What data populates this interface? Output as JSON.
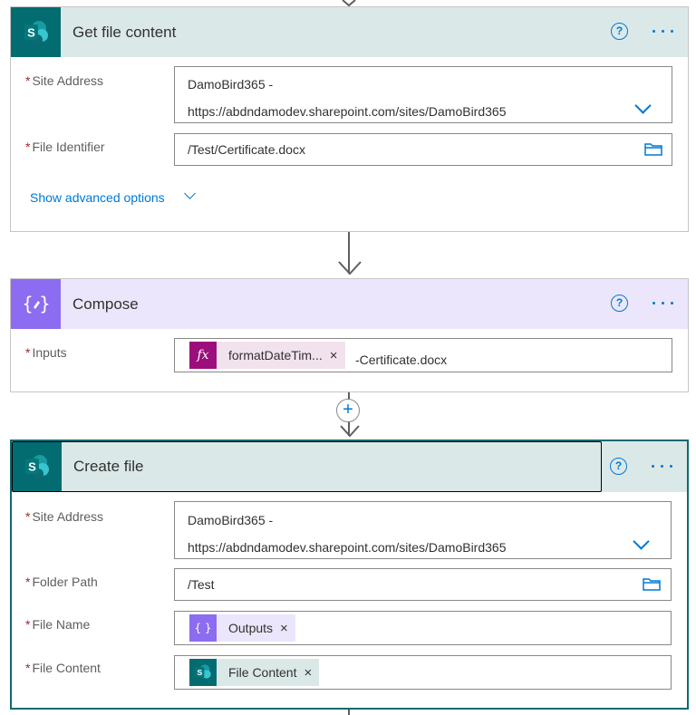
{
  "card1": {
    "title": "Get file content",
    "fields": [
      {
        "label": "Site Address",
        "line1": "DamoBird365 -",
        "line2": "https://abdndamodev.sharepoint.com/sites/DamoBird365"
      },
      {
        "label": "File Identifier",
        "value": "/Test/Certificate.docx"
      }
    ],
    "advanced_label": "Show advanced options"
  },
  "card2": {
    "title": "Compose",
    "fields": [
      {
        "label": "Inputs",
        "token": "formatDateTim...",
        "suffix": "-Certificate.docx"
      }
    ]
  },
  "card3": {
    "title": "Create file",
    "fields": [
      {
        "label": "Site Address",
        "line1": "DamoBird365 -",
        "line2": "https://abdndamodev.sharepoint.com/sites/DamoBird365"
      },
      {
        "label": "Folder Path",
        "value": "/Test"
      },
      {
        "label": "File Name",
        "token": "Outputs"
      },
      {
        "label": "File Content",
        "token": "File Content"
      }
    ]
  },
  "common": {
    "required_mark": "*",
    "help_glyph": "?",
    "close_glyph": "×",
    "add_glyph": "+",
    "fx_glyph": "fx"
  },
  "colors": {
    "sharepoint_header": "#dbe8e8",
    "sharepoint_icon": "#036c70",
    "compose_header": "#ebe6fb",
    "compose_icon": "#8c6cf0",
    "expression_token": "#9c0e7c",
    "accent": "#0078d4",
    "required": "#a4262c"
  },
  "icons": [
    "sharepoint-icon",
    "compose-icon",
    "help-icon",
    "more-icon",
    "chevron-down-icon",
    "folder-icon",
    "expression-icon",
    "close-icon",
    "add-step-icon",
    "arrow-down-icon"
  ]
}
